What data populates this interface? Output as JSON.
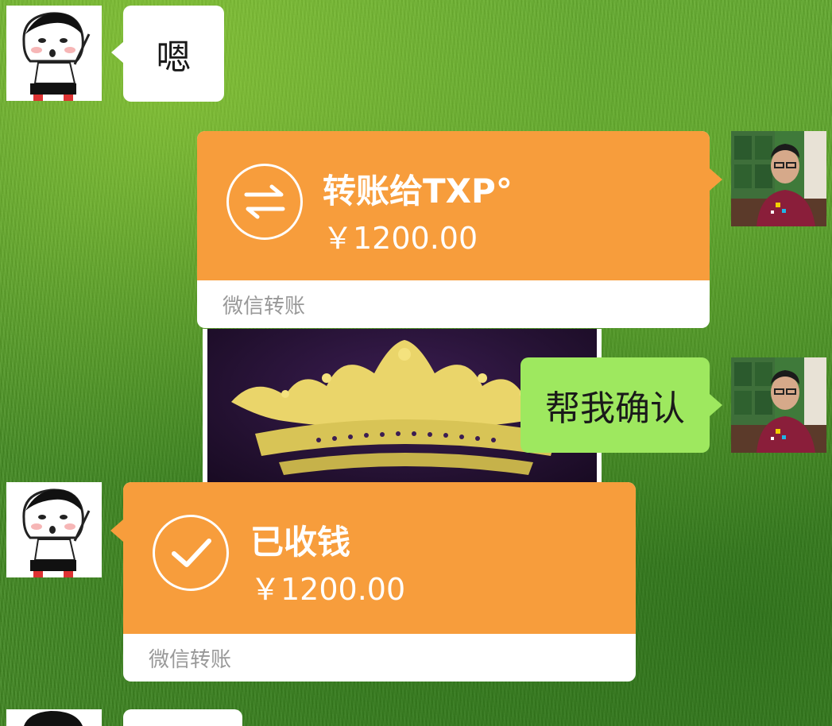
{
  "messages": {
    "m1": {
      "text": "嗯"
    },
    "m2": {
      "title": "转账给TXP°",
      "amount": "￥1200.00",
      "footer": "微信转账"
    },
    "m4": {
      "text": "帮我确认"
    },
    "m5": {
      "title": "已收钱",
      "amount": "￥1200.00",
      "footer": "微信转账"
    }
  },
  "icons": {
    "transfer": "swap-arrows-icon",
    "received": "checkmark-icon"
  },
  "colors": {
    "transfer_orange": "#f79d3c",
    "self_bubble_green": "#9ee85f",
    "other_bubble_white": "#ffffff",
    "footer_text_gray": "#999999"
  }
}
